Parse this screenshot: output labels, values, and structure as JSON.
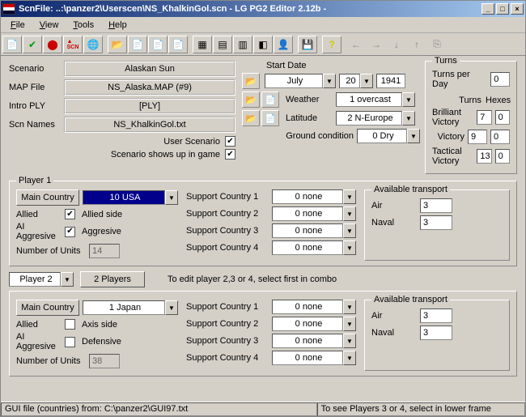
{
  "title": "ScnFile: ..:\\panzer2\\Userscen\\NS_KhalkinGol.scn   - LG PG2 Editor 2.12b -",
  "menu": {
    "file": "File",
    "view": "View",
    "tools": "Tools",
    "help": "Help"
  },
  "section1": {
    "scenario_lbl": "Scenario",
    "scenario_val": "Alaskan Sun",
    "mapfile_lbl": "MAP  File",
    "mapfile_val": "NS_Alaska.MAP (#9)",
    "introply_lbl": "Intro PLY",
    "introply_val": "[PLY]",
    "scnnames_lbl": "Scn Names",
    "scnnames_val": "NS_KhalkinGol.txt",
    "userscen_lbl": "User Scenario",
    "showsup_lbl": "Scenario shows up in game",
    "startdate_lbl": "Start Date",
    "month": "July",
    "day": "20",
    "year": "1941",
    "weather_lbl": "Weather",
    "weather_val": "1  overcast",
    "latitude_lbl": "Latitude",
    "latitude_val": "2  N-Europe",
    "ground_lbl": "Ground condition",
    "ground_val": "0  Dry"
  },
  "turns": {
    "title": "Turns",
    "tpd_lbl": "Turns per Day",
    "tpd_val": "0",
    "turns_h": "Turns",
    "hexes_h": "Hexes",
    "bv_lbl": "Brilliant Victory",
    "bv_t": "7",
    "bv_h": "0",
    "v_lbl": "Victory",
    "v_t": "9",
    "v_h": "0",
    "tv_lbl": "Tactical Victory",
    "tv_t": "13",
    "tv_h": "0"
  },
  "p1": {
    "title": "Player 1",
    "mc_lbl": "Main Country",
    "mc_val": "10 USA",
    "allied_lbl": "Allied",
    "allied_side": "Allied side",
    "aiagg_lbl": "AI Aggresive",
    "aiagg_side": "Aggresive",
    "nunits_lbl": "Number of Units",
    "nunits_val": "14",
    "sc1": "Support  Country 1",
    "sc2": "Support  Country 2",
    "sc3": "Support  Country 3",
    "sc4": "Support  Country 4",
    "sc_val": "0 none",
    "avail_title": "Available transport",
    "air_lbl": "Air",
    "air_val": "3",
    "naval_lbl": "Naval",
    "naval_val": "3"
  },
  "pselect": {
    "player_lbl": "Player  2",
    "players_btn": "2 Players",
    "hint": "To edit player 2,3 or 4, select first in combo"
  },
  "p2": {
    "mc_lbl": "Main Country",
    "mc_val": "1  Japan",
    "allied_lbl": "Allied",
    "allied_side": "Axis side",
    "aiagg_lbl": "AI Aggresive",
    "aiagg_side": "Defensive",
    "nunits_lbl": "Number of Units",
    "nunits_val": "38",
    "sc_val": "0 none",
    "avail_title": "Available transport",
    "air_lbl": "Air",
    "air_val": "3",
    "naval_lbl": "Naval",
    "naval_val": "3"
  },
  "status": {
    "left": "GUI file (countries) from: C:\\panzer2\\GUI97.txt",
    "right": "To see Players 3 or 4, select in lower frame"
  }
}
